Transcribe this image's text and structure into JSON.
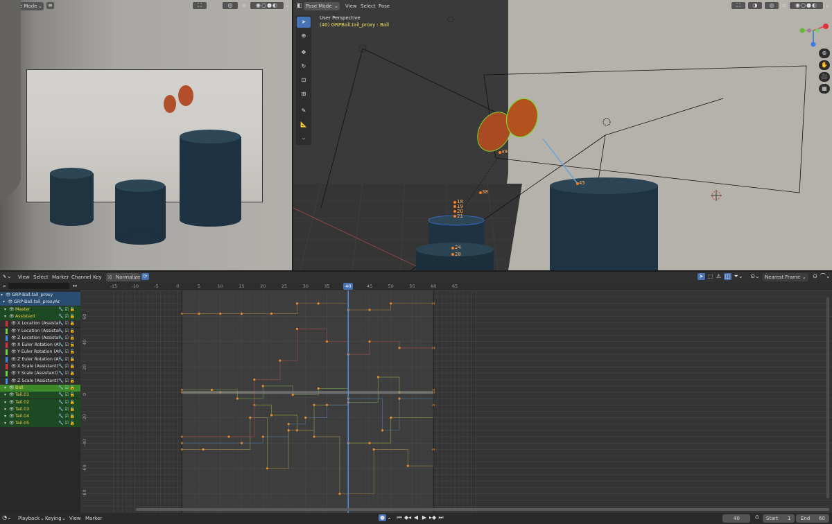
{
  "left_view": {
    "mode": "Pose Mode"
  },
  "right_view": {
    "mode": "Pose Mode",
    "menus": [
      "View",
      "Select",
      "Pose"
    ],
    "perspective": "User Perspective",
    "object": "(40) GRPBall.tail_proxy : Ball",
    "bone_labels": [
      "39",
      "38",
      "45",
      "18",
      "19",
      "20",
      "21",
      "24",
      "28"
    ]
  },
  "graph": {
    "menus": [
      "View",
      "Select",
      "Marker",
      "Channel",
      "Key"
    ],
    "normalize": "Normalize",
    "snap": "Nearest Frame",
    "x_ticks": [
      "-15",
      "-10",
      "-5",
      "0",
      "5",
      "10",
      "15",
      "20",
      "25",
      "30",
      "35",
      "40",
      "45",
      "50",
      "55",
      "60",
      "65"
    ],
    "y_ticks": [
      "60",
      "40",
      "20",
      "0",
      "-20",
      "-40",
      "-60",
      "-80"
    ],
    "current_frame": "40",
    "channels": [
      {
        "label": "GRP-Ball.tail_proxy",
        "kind": "object",
        "color": "#2b4d72"
      },
      {
        "label": "GRP-Ball.tail_proxyAction",
        "kind": "action",
        "color": "#2b4d72"
      },
      {
        "label": "Master",
        "kind": "group",
        "color": "#1d4a22"
      },
      {
        "label": "Assistant",
        "kind": "group",
        "color": "#1d4a22"
      },
      {
        "label": "X Location (Assistar",
        "kind": "fcurve",
        "color": "#e0323c"
      },
      {
        "label": "Y Location (Assistar",
        "kind": "fcurve",
        "color": "#6ad53b"
      },
      {
        "label": "Z Location (Assistar",
        "kind": "fcurve",
        "color": "#3d8ce6"
      },
      {
        "label": "X Euler Rotation (As",
        "kind": "fcurve",
        "color": "#e0323c"
      },
      {
        "label": "Y Euler Rotation (As",
        "kind": "fcurve",
        "color": "#6ad53b"
      },
      {
        "label": "Z Euler Rotation (As",
        "kind": "fcurve",
        "color": "#3d8ce6"
      },
      {
        "label": "X Scale (Assistant)",
        "kind": "fcurve",
        "color": "#e0323c"
      },
      {
        "label": "Y Scale (Assistant)",
        "kind": "fcurve",
        "color": "#6ad53b"
      },
      {
        "label": "Z Scale (Assistant)",
        "kind": "fcurve",
        "color": "#3d8ce6"
      },
      {
        "label": "Ball",
        "kind": "group-active",
        "color": "#3e8a2a"
      },
      {
        "label": "Tail.01",
        "kind": "group",
        "color": "#1d4a22"
      },
      {
        "label": "Tail.02",
        "kind": "group",
        "color": "#1d4a22"
      },
      {
        "label": "Tail.03",
        "kind": "group",
        "color": "#1d4a22"
      },
      {
        "label": "Tail.04",
        "kind": "group",
        "color": "#1d4a22"
      },
      {
        "label": "Tail.05",
        "kind": "group",
        "color": "#1d4a22"
      }
    ]
  },
  "timeline": {
    "menus": [
      "Playback",
      "Keying",
      "View",
      "Marker"
    ],
    "frame": "40",
    "start_label": "Start",
    "start": "1",
    "end_label": "End",
    "end": "60"
  },
  "colors": {
    "accent": "#4772b3",
    "playhead": "#4f8fe0",
    "key": "#e88b2c",
    "keySel": "#ffb64d"
  }
}
